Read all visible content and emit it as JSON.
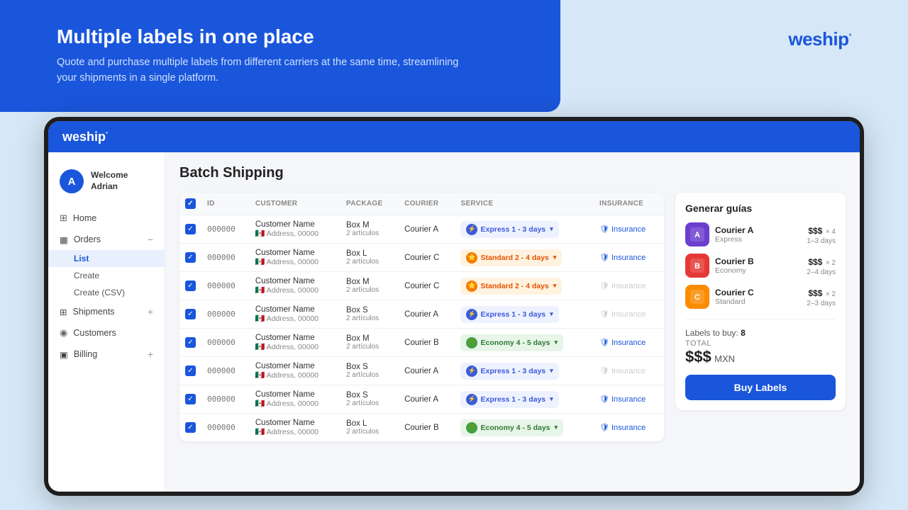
{
  "banner": {
    "title": "Multiple labels in one place",
    "subtitle": "Quote and purchase multiple labels from different carriers at the same time, streamlining your shipments in a single platform."
  },
  "logo": {
    "text": "weship",
    "superscript": "°"
  },
  "app_header": {
    "logo": "weship",
    "logo_sup": "°"
  },
  "sidebar": {
    "avatar_letter": "A",
    "user_greeting": "Welcome",
    "user_name": "Adrian",
    "nav": [
      {
        "label": "Home",
        "icon": "🏠"
      },
      {
        "label": "Orders",
        "icon": "📋",
        "expandable": true,
        "subitems": [
          "List",
          "Create",
          "Create (CSV)"
        ]
      },
      {
        "label": "Shipments",
        "icon": "📦",
        "expandable": true
      },
      {
        "label": "Customers",
        "icon": "👤",
        "expandable": false
      },
      {
        "label": "Billing",
        "icon": "💳",
        "expandable": true
      }
    ]
  },
  "page": {
    "title": "Batch Shipping"
  },
  "table": {
    "headers": [
      "",
      "ID",
      "CUSTOMER",
      "PACKAGE",
      "COURIER",
      "SERVICE",
      "INSURANCE"
    ],
    "rows": [
      {
        "id": "000000",
        "customer_name": "Customer Name",
        "customer_flag": "🇲🇽",
        "customer_addr": "Address, 00000",
        "package": "Box M",
        "articles": "2 artículos",
        "courier": "Courier A",
        "service": "Express 1 - 3 days",
        "service_type": "express",
        "insurance": "Insurance",
        "insurance_active": true
      },
      {
        "id": "000000",
        "customer_name": "Customer Name",
        "customer_flag": "🇲🇽",
        "customer_addr": "Address, 00000",
        "package": "Box L",
        "articles": "2 artículos",
        "courier": "Courier C",
        "service": "Standard 2 - 4 days",
        "service_type": "standard",
        "insurance": "Insurance",
        "insurance_active": true
      },
      {
        "id": "000000",
        "customer_name": "Customer Name",
        "customer_flag": "🇲🇽",
        "customer_addr": "Address, 00000",
        "package": "Box M",
        "articles": "2 artículos",
        "courier": "Courier C",
        "service": "Standard 2 - 4 days",
        "service_type": "standard",
        "insurance": "Insurance",
        "insurance_active": false
      },
      {
        "id": "000000",
        "customer_name": "Customer Name",
        "customer_flag": "🇲🇽",
        "customer_addr": "Address, 00000",
        "package": "Box S",
        "articles": "2 artículos",
        "courier": "Courier A",
        "service": "Express 1 - 3 days",
        "service_type": "express",
        "insurance": "Insurance",
        "insurance_active": false
      },
      {
        "id": "000000",
        "customer_name": "Customer Name",
        "customer_flag": "🇲🇽",
        "customer_addr": "Address, 00000",
        "package": "Box M",
        "articles": "2 artículos",
        "courier": "Courier B",
        "service": "Economy 4 - 5 days",
        "service_type": "economy",
        "insurance": "Insurance",
        "insurance_active": true
      },
      {
        "id": "000000",
        "customer_name": "Customer Name",
        "customer_flag": "🇲🇽",
        "customer_addr": "Address, 00000",
        "package": "Box S",
        "articles": "2 artículos",
        "courier": "Courier A",
        "service": "Express 1 - 3 days",
        "service_type": "express",
        "insurance": "Insurance",
        "insurance_active": false
      },
      {
        "id": "000000",
        "customer_name": "Customer Name",
        "customer_flag": "🇲🇽",
        "customer_addr": "Address, 00000",
        "package": "Box S",
        "articles": "2 artículos",
        "courier": "Courier A",
        "service": "Express 1 - 3 days",
        "service_type": "express",
        "insurance": "Insurance",
        "insurance_active": true
      },
      {
        "id": "000000",
        "customer_name": "Customer Name",
        "customer_flag": "🇲🇽",
        "customer_addr": "Address, 00000",
        "package": "Box L",
        "articles": "2 artículos",
        "courier": "Courier B",
        "service": "Economy 4 - 5 days",
        "service_type": "economy",
        "insurance": "Insurance",
        "insurance_active": true
      }
    ]
  },
  "right_panel": {
    "title": "Generar guías",
    "couriers": [
      {
        "name": "Courier A",
        "type": "Express",
        "price": "$$$",
        "count": "× 4",
        "days": "1–3 days",
        "logo_class": "courier-logo-a",
        "emoji": "📦"
      },
      {
        "name": "Courier B",
        "type": "Economy",
        "price": "$$$",
        "count": "× 2",
        "days": "2–4 days",
        "logo_class": "courier-logo-b",
        "emoji": "📦"
      },
      {
        "name": "Courier C",
        "type": "Standard",
        "price": "$$$",
        "count": "× 2",
        "days": "2–3 days",
        "logo_class": "courier-logo-c",
        "emoji": "📦"
      }
    ],
    "labels_prefix": "Labels to buy:",
    "labels_count": "8",
    "total_label": "TOTAL",
    "total_price": "$$$",
    "total_currency": "MXN",
    "buy_button": "Buy Labels"
  }
}
